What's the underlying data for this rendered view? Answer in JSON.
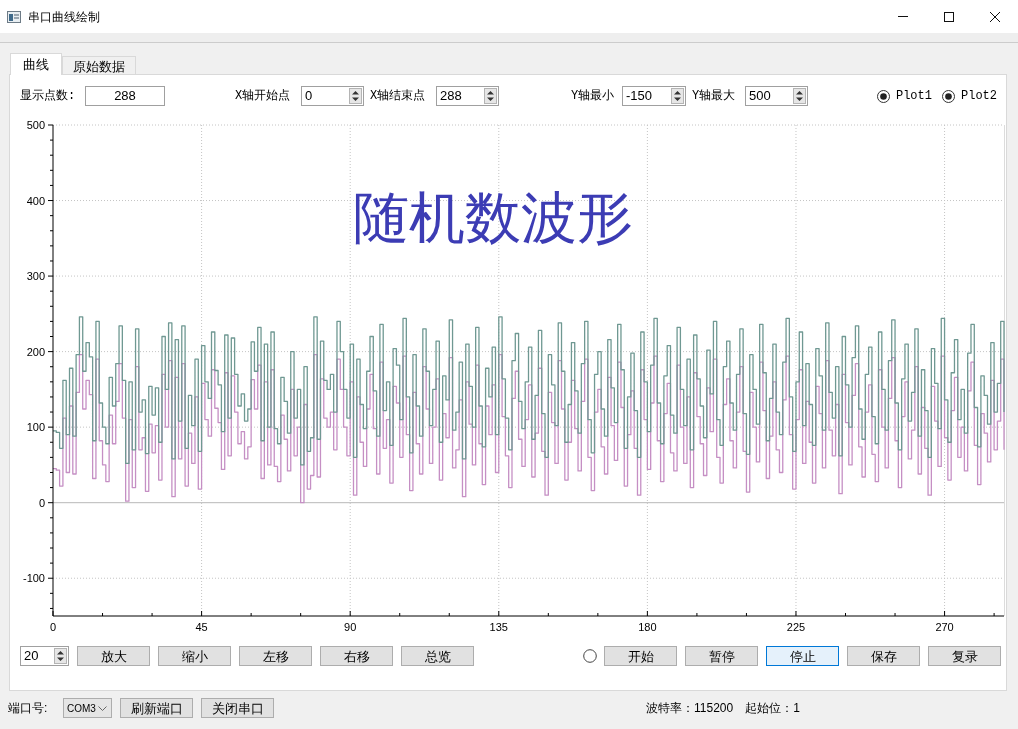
{
  "window": {
    "title": "串口曲线绘制"
  },
  "tabs": [
    {
      "label": "曲线",
      "selected": true
    },
    {
      "label": "原始数据",
      "selected": false
    }
  ],
  "settings": [
    {
      "kind": "field",
      "label": "显示点数:",
      "value": "288"
    },
    {
      "kind": "spin",
      "label": "X轴开始点",
      "value": "0"
    },
    {
      "kind": "spin",
      "label": "X轴结束点",
      "value": "288"
    },
    {
      "kind": "spin",
      "label": "Y轴最小",
      "value": "-150"
    },
    {
      "kind": "spin",
      "label": "Y轴最大",
      "value": "500"
    }
  ],
  "plots": [
    {
      "label": "Plot1",
      "checked": true
    },
    {
      "label": "Plot2",
      "checked": true
    }
  ],
  "chart": {
    "chart_data": {
      "type": "line",
      "title": "随机数波形",
      "grid": true,
      "xlim": [
        0,
        288
      ],
      "ylim": [
        -150,
        500
      ],
      "xticks": [
        0,
        45,
        90,
        135,
        180,
        225,
        270
      ],
      "yticks": [
        -100,
        0,
        100,
        200,
        300,
        400,
        500
      ],
      "x": [
        0,
        1,
        1,
        2,
        2,
        3,
        3,
        4,
        4,
        5,
        5,
        6,
        6,
        7,
        7,
        8,
        8,
        9,
        9,
        10,
        10,
        11,
        11,
        12,
        12,
        13,
        13,
        14,
        14,
        15,
        15,
        16,
        16,
        17,
        17,
        18,
        18,
        19,
        19,
        20,
        20,
        21,
        21,
        22,
        22,
        23,
        23,
        24,
        24,
        25,
        25,
        26,
        26,
        27,
        27,
        28,
        28,
        29,
        29,
        30,
        30,
        31,
        31,
        32,
        32,
        33,
        33,
        34,
        34,
        35,
        35,
        36,
        36,
        37,
        37,
        38,
        38,
        39,
        39,
        40,
        40,
        41,
        41,
        42,
        42,
        43,
        43,
        44,
        44,
        45,
        45,
        46,
        46,
        47,
        47,
        48,
        48,
        49,
        49,
        50,
        50,
        51,
        51,
        52,
        52,
        53,
        53,
        54,
        54,
        55,
        55,
        56,
        56,
        57,
        57,
        58,
        58,
        59,
        59,
        60,
        60,
        61,
        61,
        62,
        62,
        63,
        63,
        64,
        64,
        65,
        65,
        66,
        66,
        67,
        67,
        68,
        68,
        69,
        69,
        70,
        70,
        71,
        71,
        72,
        72,
        73,
        73,
        74,
        74,
        75,
        75,
        76,
        76,
        77,
        77,
        78,
        78,
        79,
        79,
        80,
        80,
        81,
        81,
        82,
        82,
        83,
        83,
        84,
        84,
        85,
        85,
        86,
        86,
        87,
        87,
        88,
        88,
        89,
        89,
        90,
        90,
        91,
        91,
        92,
        92,
        93,
        93,
        94,
        94,
        95,
        95,
        96,
        96,
        97,
        97,
        98,
        98,
        99,
        99,
        100,
        100,
        101,
        101,
        102,
        102,
        103,
        103,
        104,
        104,
        105,
        105,
        106,
        106,
        107,
        107,
        108,
        108,
        109,
        109,
        110,
        110,
        111,
        111,
        112,
        112,
        113,
        113,
        114,
        114,
        115,
        115,
        116,
        116,
        117,
        117,
        118,
        118,
        119,
        119,
        120,
        120,
        121,
        121,
        122,
        122,
        123,
        123,
        124,
        124,
        125,
        125,
        126,
        126,
        127,
        127,
        128,
        128,
        129,
        129,
        130,
        130,
        131,
        131,
        132,
        132,
        133,
        133,
        134,
        134,
        135,
        135,
        136,
        136,
        137,
        137,
        138,
        138,
        139,
        139,
        140,
        140,
        141,
        141,
        142,
        142,
        143,
        143,
        144,
        144,
        145,
        145,
        146,
        146,
        147,
        147,
        148,
        148,
        149,
        149,
        150,
        150,
        151,
        151,
        152,
        152,
        153,
        153,
        154,
        154,
        155,
        155,
        156,
        156,
        157,
        157,
        158,
        158,
        159,
        159,
        160,
        160,
        161,
        161,
        162,
        162,
        163,
        163,
        164,
        164,
        165,
        165,
        166,
        166,
        167,
        167,
        168,
        168,
        169,
        169,
        170,
        170,
        171,
        171,
        172,
        172,
        173,
        173,
        174,
        174,
        175,
        175,
        176,
        176,
        177,
        177,
        178,
        178,
        179,
        179,
        180,
        180,
        181,
        181,
        182,
        182,
        183,
        183,
        184,
        184,
        185,
        185,
        186,
        186,
        187,
        187,
        188,
        188,
        189,
        189,
        190,
        190,
        191,
        191,
        192,
        192,
        193,
        193,
        194,
        194,
        195,
        195,
        196,
        196,
        197,
        197,
        198,
        198,
        199,
        199,
        200,
        200,
        201,
        201,
        202,
        202,
        203,
        203,
        204,
        204,
        205,
        205,
        206,
        206,
        207,
        207,
        208,
        208,
        209,
        209,
        210,
        210,
        211,
        211,
        212,
        212,
        213,
        213,
        214,
        214,
        215,
        215,
        216,
        216,
        217,
        217,
        218,
        218,
        219,
        219,
        220,
        220,
        221,
        221,
        222,
        222,
        223,
        223,
        224,
        224,
        225,
        225,
        226,
        226,
        227,
        227,
        228,
        228,
        229,
        229,
        230,
        230,
        231,
        231,
        232,
        232,
        233,
        233,
        234,
        234,
        235,
        235,
        236,
        236,
        237,
        237,
        238,
        238,
        239,
        239,
        240,
        240,
        241,
        241,
        242,
        242,
        243,
        243,
        244,
        244,
        245,
        245,
        246,
        246,
        247,
        247,
        248,
        248,
        249,
        249,
        250,
        250,
        251,
        251,
        252,
        252,
        253,
        253,
        254,
        254,
        255,
        255,
        256,
        256,
        257,
        257,
        258,
        258,
        259,
        259,
        260,
        260,
        261,
        261,
        262,
        262,
        263,
        263,
        264,
        264,
        265,
        265,
        266,
        266,
        267,
        267,
        268,
        268,
        269,
        269,
        270,
        270,
        271,
        271,
        272,
        272,
        273,
        273,
        274,
        274,
        275,
        275,
        276,
        276,
        277,
        277,
        278,
        278,
        279,
        279,
        280,
        280,
        281,
        281,
        282,
        282,
        283,
        283,
        284,
        284,
        285,
        285,
        286,
        286,
        287,
        287,
        288,
        288
      ],
      "series": [
        {
          "color": "#6f9892",
          "values": [
            95,
            95,
            93,
            93,
            72,
            72,
            162,
            162,
            90,
            90,
            178,
            178,
            88,
            88,
            196,
            196,
            246,
            246,
            174,
            174,
            212,
            212,
            193,
            193,
            82,
            82,
            240,
            240,
            132,
            132,
            100,
            100,
            78,
            78,
            166,
            166,
            128,
            128,
            184,
            184,
            234,
            234,
            162,
            162,
            52,
            52,
            160,
            160,
            70,
            70,
            230,
            230,
            120,
            120,
            136,
            136,
            65,
            65,
            154,
            154,
            116,
            116,
            152,
            152,
            80,
            80,
            220,
            220,
            150,
            150,
            238,
            238,
            58,
            58,
            216,
            216,
            108,
            108,
            234,
            234,
            72,
            72,
            142,
            142,
            102,
            102,
            190,
            190,
            68,
            68,
            208,
            208,
            160,
            160,
            138,
            138,
            226,
            226,
            175,
            175,
            156,
            156,
            94,
            94,
            222,
            222,
            112,
            112,
            218,
            218,
            170,
            170,
            128,
            128,
            144,
            144,
            108,
            108,
            124,
            124,
            213,
            213,
            174,
            174,
            232,
            232,
            82,
            82,
            210,
            210,
            100,
            100,
            226,
            226,
            98,
            98,
            78,
            78,
            166,
            166,
            134,
            134,
            92,
            92,
            200,
            200,
            112,
            112,
            150,
            150,
            50,
            50,
            180,
            180,
            68,
            68,
            86,
            86,
            246,
            246,
            84,
            84,
            214,
            214,
            162,
            162,
            150,
            150,
            170,
            170,
            120,
            120,
            240,
            240,
            200,
            200,
            150,
            150,
            112,
            112,
            210,
            210,
            60,
            60,
            190,
            190,
            130,
            130,
            98,
            98,
            174,
            174,
            220,
            220,
            148,
            148,
            88,
            88,
            236,
            236,
            122,
            122,
            160,
            160,
            76,
            76,
            204,
            204,
            182,
            182,
            110,
            110,
            244,
            244,
            140,
            140,
            66,
            66,
            196,
            196,
            128,
            128,
            88,
            88,
            230,
            230,
            174,
            174,
            102,
            102,
            150,
            150,
            214,
            214,
            80,
            80,
            168,
            168,
            136,
            136,
            242,
            242,
            96,
            96,
            120,
            120,
            186,
            186,
            58,
            58,
            210,
            210,
            154,
            154,
            100,
            100,
            232,
            232,
            128,
            128,
            74,
            74,
            178,
            178,
            140,
            140,
            206,
            206,
            90,
            90,
            246,
            246,
            164,
            164,
            112,
            112,
            70,
            70,
            188,
            188,
            224,
            224,
            134,
            134,
            98,
            98,
            160,
            160,
            206,
            206,
            84,
            84,
            142,
            142,
            228,
            228,
            118,
            118,
            60,
            60,
            196,
            196,
            156,
            156,
            102,
            102,
            238,
            238,
            174,
            174,
            80,
            80,
            130,
            130,
            212,
            212,
            148,
            148,
            92,
            92,
            184,
            184,
            240,
            240,
            110,
            110,
            66,
            66,
            170,
            170,
            200,
            200,
            124,
            124,
            88,
            88,
            216,
            216,
            152,
            152,
            106,
            106,
            236,
            236,
            176,
            176,
            72,
            72,
            140,
            140,
            198,
            198,
            122,
            122,
            60,
            60,
            226,
            226,
            160,
            160,
            94,
            94,
            182,
            182,
            244,
            244,
            132,
            132,
            78,
            78,
            168,
            168,
            208,
            208,
            116,
            116,
            92,
            92,
            232,
            232,
            150,
            150,
            102,
            102,
            190,
            190,
            70,
            70,
            222,
            222,
            164,
            164,
            128,
            128,
            86,
            86,
            202,
            202,
            144,
            144,
            240,
            240,
            110,
            110,
            76,
            76,
            180,
            180,
            214,
            214,
            132,
            132,
            96,
            96,
            170,
            170,
            230,
            230,
            118,
            118,
            64,
            64,
            196,
            196,
            150,
            150,
            104,
            104,
            236,
            236,
            172,
            172,
            82,
            82,
            138,
            138,
            210,
            210,
            120,
            120,
            90,
            90,
            186,
            186,
            244,
            244,
            140,
            140,
            68,
            68,
            160,
            160,
            226,
            226,
            102,
            102,
            184,
            184,
            130,
            130,
            76,
            76,
            204,
            204,
            168,
            168,
            96,
            96,
            238,
            238,
            146,
            146,
            112,
            112,
            180,
            180,
            62,
            62,
            220,
            220,
            156,
            156,
            100,
            100,
            192,
            192,
            234,
            234,
            124,
            124,
            84,
            84,
            170,
            170,
            206,
            206,
            114,
            114,
            78,
            78,
            226,
            226,
            150,
            150,
            96,
            96,
            188,
            188,
            242,
            242,
            132,
            132,
            70,
            70,
            164,
            164,
            210,
            210,
            108,
            108,
            146,
            146,
            230,
            230,
            88,
            88,
            176,
            176,
            122,
            122,
            60,
            60,
            204,
            204,
            158,
            158,
            98,
            98,
            244,
            244,
            136,
            136,
            80,
            80,
            172,
            172,
            216,
            216,
            110,
            110,
            150,
            150,
            92,
            92,
            198,
            198,
            236,
            236,
            126,
            126,
            74,
            74,
            168,
            168,
            142,
            142,
            104,
            104,
            212,
            212,
            120,
            120,
            158,
            158,
            240,
            240,
            120
          ]
        },
        {
          "color": "#c58fc4",
          "values": [
            45,
            45,
            43,
            43,
            22,
            22,
            112,
            112,
            40,
            40,
            128,
            128,
            38,
            38,
            146,
            146,
            196,
            196,
            124,
            124,
            162,
            162,
            143,
            143,
            32,
            32,
            190,
            190,
            82,
            82,
            50,
            50,
            28,
            28,
            116,
            116,
            78,
            78,
            134,
            134,
            184,
            184,
            112,
            112,
            2,
            2,
            110,
            110,
            20,
            20,
            180,
            180,
            70,
            70,
            86,
            86,
            15,
            15,
            104,
            104,
            66,
            66,
            102,
            102,
            30,
            30,
            170,
            170,
            100,
            100,
            188,
            188,
            8,
            8,
            166,
            166,
            58,
            58,
            184,
            184,
            22,
            22,
            92,
            92,
            52,
            52,
            140,
            140,
            18,
            18,
            158,
            158,
            110,
            110,
            88,
            88,
            176,
            176,
            125,
            125,
            106,
            106,
            44,
            44,
            172,
            172,
            62,
            62,
            168,
            168,
            120,
            120,
            78,
            78,
            94,
            94,
            58,
            58,
            74,
            74,
            163,
            163,
            124,
            124,
            182,
            182,
            32,
            32,
            160,
            160,
            50,
            50,
            176,
            176,
            48,
            48,
            28,
            28,
            116,
            116,
            84,
            84,
            42,
            42,
            150,
            150,
            62,
            62,
            100,
            100,
            0,
            0,
            130,
            130,
            18,
            18,
            36,
            36,
            196,
            196,
            34,
            34,
            164,
            164,
            112,
            112,
            100,
            100,
            120,
            120,
            70,
            70,
            190,
            190,
            150,
            150,
            100,
            100,
            62,
            62,
            160,
            160,
            10,
            10,
            140,
            140,
            80,
            80,
            48,
            48,
            124,
            124,
            170,
            170,
            98,
            98,
            38,
            38,
            186,
            186,
            72,
            72,
            110,
            110,
            26,
            26,
            154,
            154,
            132,
            132,
            60,
            60,
            194,
            194,
            90,
            90,
            16,
            16,
            146,
            146,
            78,
            78,
            38,
            38,
            180,
            180,
            124,
            124,
            52,
            52,
            100,
            100,
            164,
            164,
            30,
            30,
            118,
            118,
            86,
            86,
            192,
            192,
            46,
            46,
            70,
            70,
            136,
            136,
            8,
            8,
            160,
            160,
            104,
            104,
            50,
            50,
            182,
            182,
            78,
            78,
            24,
            24,
            128,
            128,
            90,
            90,
            156,
            156,
            40,
            40,
            196,
            196,
            114,
            114,
            62,
            62,
            20,
            20,
            138,
            138,
            174,
            174,
            84,
            84,
            48,
            48,
            110,
            110,
            156,
            156,
            34,
            34,
            92,
            92,
            178,
            178,
            68,
            68,
            10,
            10,
            146,
            146,
            106,
            106,
            52,
            52,
            188,
            188,
            124,
            124,
            30,
            30,
            80,
            80,
            162,
            162,
            98,
            98,
            42,
            42,
            134,
            134,
            190,
            190,
            60,
            60,
            16,
            16,
            120,
            120,
            150,
            150,
            74,
            74,
            38,
            38,
            166,
            166,
            102,
            102,
            56,
            56,
            186,
            186,
            126,
            126,
            22,
            22,
            90,
            90,
            148,
            148,
            72,
            72,
            10,
            10,
            176,
            176,
            110,
            110,
            44,
            44,
            132,
            132,
            194,
            194,
            82,
            82,
            28,
            28,
            118,
            118,
            158,
            158,
            66,
            66,
            42,
            42,
            182,
            182,
            100,
            100,
            52,
            52,
            140,
            140,
            20,
            20,
            172,
            172,
            114,
            114,
            78,
            78,
            36,
            36,
            152,
            152,
            94,
            94,
            190,
            190,
            60,
            60,
            26,
            26,
            130,
            130,
            164,
            164,
            82,
            82,
            46,
            46,
            120,
            120,
            180,
            180,
            68,
            68,
            14,
            14,
            146,
            146,
            100,
            100,
            54,
            54,
            186,
            186,
            122,
            122,
            32,
            32,
            88,
            88,
            160,
            160,
            70,
            70,
            40,
            40,
            136,
            136,
            194,
            194,
            90,
            90,
            18,
            18,
            110,
            110,
            176,
            176,
            52,
            52,
            134,
            134,
            80,
            80,
            26,
            26,
            154,
            154,
            118,
            118,
            46,
            46,
            188,
            188,
            96,
            96,
            62,
            62,
            130,
            130,
            12,
            12,
            170,
            170,
            106,
            106,
            50,
            50,
            142,
            142,
            184,
            184,
            74,
            74,
            34,
            34,
            120,
            120,
            156,
            156,
            64,
            64,
            28,
            28,
            176,
            176,
            100,
            100,
            46,
            46,
            138,
            138,
            192,
            192,
            82,
            82,
            20,
            20,
            114,
            114,
            160,
            160,
            58,
            58,
            96,
            96,
            180,
            180,
            38,
            38,
            126,
            126,
            72,
            72,
            10,
            10,
            154,
            154,
            108,
            108,
            48,
            48,
            194,
            194,
            86,
            86,
            30,
            30,
            122,
            122,
            166,
            166,
            60,
            60,
            100,
            100,
            42,
            42,
            148,
            148,
            186,
            186,
            76,
            76,
            24,
            24,
            118,
            118,
            92,
            92,
            54,
            54,
            162,
            162,
            70,
            70,
            108,
            108,
            190,
            190,
            70
          ]
        }
      ]
    }
  },
  "zoom_step": {
    "value": "20"
  },
  "view_buttons": [
    "放大",
    "缩小",
    "左移",
    "右移",
    "总览"
  ],
  "run_indicator": {
    "on": false
  },
  "run_buttons": [
    {
      "label": "开始",
      "focused": false
    },
    {
      "label": "暂停",
      "focused": false
    },
    {
      "label": "停止",
      "focused": true
    },
    {
      "label": "保存",
      "focused": false
    },
    {
      "label": "复录",
      "focused": false
    }
  ],
  "port": {
    "label": "端口号:",
    "value": "COM3"
  },
  "port_buttons": [
    "刷新端口",
    "关闭串口"
  ],
  "status": [
    "波特率：115200",
    "起始位：1"
  ]
}
